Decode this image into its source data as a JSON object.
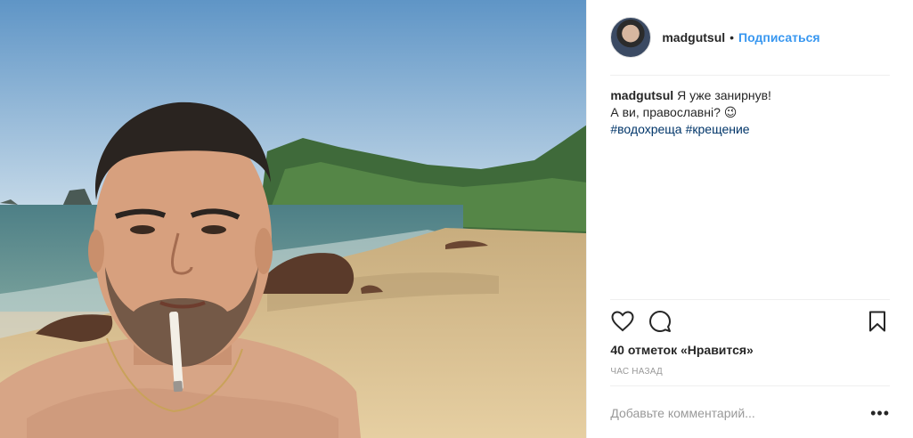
{
  "post": {
    "username": "madgutsul",
    "separator": "•",
    "follow_label": "Подписаться",
    "caption": {
      "username": "madgutsul",
      "line1": "Я уже занирнув!",
      "line2": "А ви, православні? 😉",
      "hashtags": [
        "#водохреща",
        "#крещение"
      ]
    },
    "likes_text": "40 отметок «Нравится»",
    "time_text": "ЧАС НАЗАД",
    "comment_placeholder": "Добавьте комментарий...",
    "more_label": "•••"
  },
  "icons": {
    "like": "heart-icon",
    "comment": "comment-icon",
    "save": "bookmark-icon",
    "more": "more-options-icon"
  },
  "colors": {
    "follow": "#3897f0",
    "hashtag": "#003569",
    "muted": "#999999",
    "text": "#262626"
  }
}
